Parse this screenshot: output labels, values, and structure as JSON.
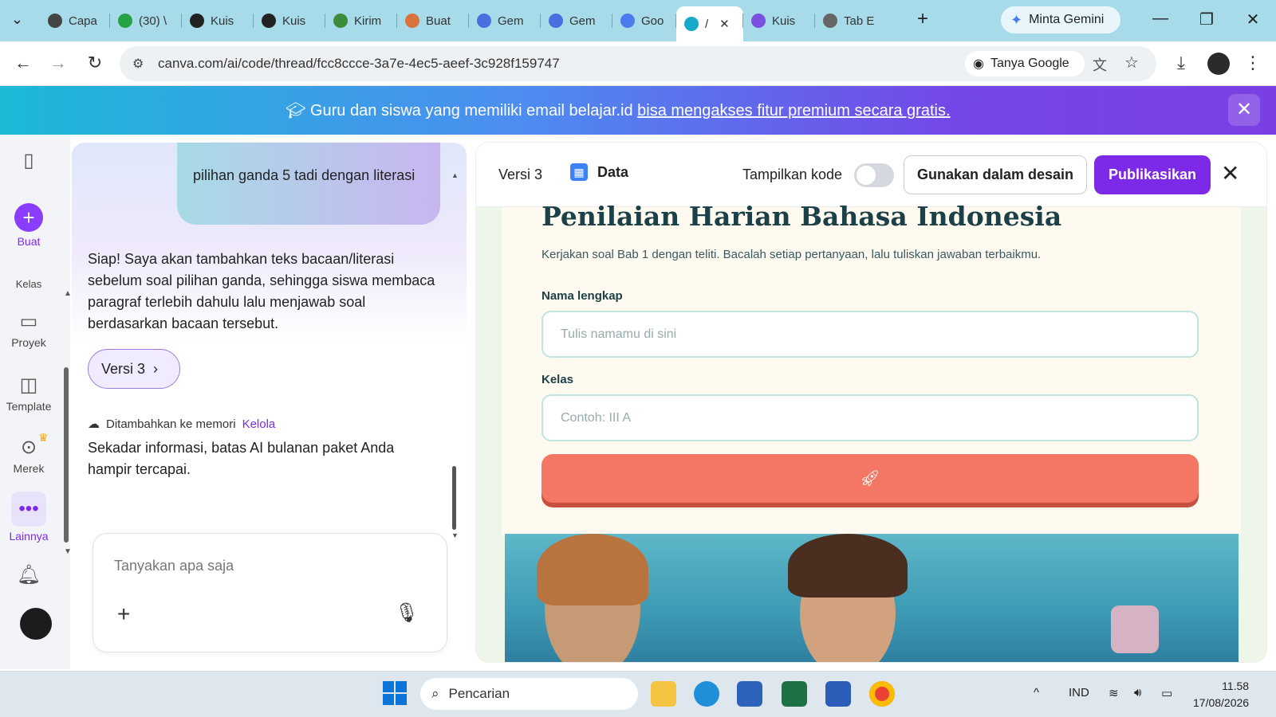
{
  "browser": {
    "tabs": [
      {
        "label": "Capa",
        "icon": "pinwheel-icon",
        "color": "#444444"
      },
      {
        "label": "(30) \\",
        "icon": "whatsapp-icon",
        "color": "#25a244"
      },
      {
        "label": "Kuis",
        "icon": "canva-icon",
        "color": "#222222"
      },
      {
        "label": "Kuis",
        "icon": "canva-icon",
        "color": "#222222"
      },
      {
        "label": "Kirim",
        "icon": "globe-icon",
        "color": "#3c8c3c"
      },
      {
        "label": "Buat",
        "icon": "claude-icon",
        "color": "#d9733b"
      },
      {
        "label": "Gem",
        "icon": "gemini-icon",
        "color": "#4a6fe0"
      },
      {
        "label": "Gem",
        "icon": "gemini-icon",
        "color": "#4a6fe0"
      },
      {
        "label": "Goo",
        "icon": "google-gemini-icon",
        "color": "#4b7bec"
      },
      {
        "label": "/",
        "icon": "canva-icon",
        "color": "#18a9c9"
      },
      {
        "label": "Kuis",
        "icon": "forms-icon",
        "color": "#7b4fe0"
      },
      {
        "label": "Tab E",
        "icon": "chrome-icon",
        "color": "#666666"
      }
    ],
    "gemini_label": "Minta Gemini",
    "url": "canva.com/ai/code/thread/fcc8ccce-3a7e-4ec5-aeef-3c928f159747",
    "tanya_google": "Tanya Google"
  },
  "banner": {
    "text": "Guru dan siswa yang memiliki email belajar.id ",
    "link": "bisa mengakses fitur premium secara gratis."
  },
  "rail": {
    "buat": "Buat",
    "kelas": "Kelas",
    "proyek": "Proyek",
    "template": "Template",
    "merek": "Merek",
    "lainnya": "Lainnya"
  },
  "chat": {
    "user_bubble": "pilihan ganda 5 tadi dengan literasi",
    "reply": "Siap! Saya akan tambahkan teks bacaan/literasi sebelum soal pilihan ganda, sehingga siswa membaca paragraf terlebih dahulu lalu menjawab soal berdasarkan bacaan tersebut.",
    "version_chip": "Versi 3",
    "memory_text": "Ditambahkan ke memori",
    "memory_link": "Kelola",
    "notice": "Sekadar informasi, batas AI bulanan paket Anda hampir tercapai.",
    "input_placeholder": "Tanyakan apa saja"
  },
  "preview": {
    "version": "Versi 3",
    "data_label": "Data",
    "toggle_label": "Tampilkan kode",
    "use_button": "Gunakan dalam desain",
    "publish_button": "Publikasikan",
    "title": "Penilaian Harian Bahasa Indonesia",
    "subtitle": "Kerjakan soal Bab 1 dengan teliti. Bacalah setiap pertanyaan, lalu tuliskan jawaban terbaikmu.",
    "name_label": "Nama lengkap",
    "name_placeholder": "Tulis namamu di sini",
    "class_label": "Kelas",
    "class_placeholder": "Contoh: III A"
  },
  "taskbar": {
    "search_placeholder": "Pencarian",
    "language": "IND",
    "time": "11.58",
    "date": "17/08/2026"
  },
  "colors": {
    "canva_purple": "#7d2ae8",
    "submit_coral": "#f47664",
    "title_teal": "#1b4048"
  }
}
